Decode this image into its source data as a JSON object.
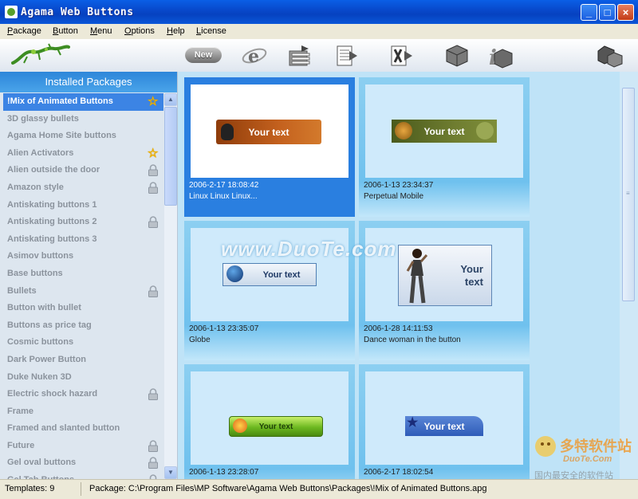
{
  "window": {
    "title": "Agama Web Buttons"
  },
  "menu": [
    "Package",
    "Button",
    "Menu",
    "Options",
    "Help",
    "License"
  ],
  "toolbar": {
    "new_label": "New"
  },
  "sidebar": {
    "header": "Installed Packages",
    "items": [
      {
        "label": "!Mix of Animated Buttons",
        "icon": "star-icon",
        "selected": true
      },
      {
        "label": "3D glassy bullets",
        "icon": ""
      },
      {
        "label": "Agama Home Site buttons",
        "icon": ""
      },
      {
        "label": "Alien Activators",
        "icon": "star-icon"
      },
      {
        "label": "Alien outside the door",
        "icon": "lock-icon"
      },
      {
        "label": "Amazon style",
        "icon": "lock-icon"
      },
      {
        "label": "Antiskating buttons 1",
        "icon": ""
      },
      {
        "label": "Antiskating buttons 2",
        "icon": "lock-icon"
      },
      {
        "label": "Antiskating buttons 3",
        "icon": ""
      },
      {
        "label": "Asimov buttons",
        "icon": ""
      },
      {
        "label": "Base buttons",
        "icon": ""
      },
      {
        "label": "Bullets",
        "icon": "lock-icon"
      },
      {
        "label": "Button with bullet",
        "icon": ""
      },
      {
        "label": "Buttons as price tag",
        "icon": ""
      },
      {
        "label": "Cosmic buttons",
        "icon": ""
      },
      {
        "label": "Dark Power Button",
        "icon": ""
      },
      {
        "label": "Duke Nuken 3D",
        "icon": ""
      },
      {
        "label": "Electric shock hazard",
        "icon": "lock-icon"
      },
      {
        "label": "Frame",
        "icon": ""
      },
      {
        "label": "Framed and slanted button",
        "icon": ""
      },
      {
        "label": "Future",
        "icon": "lock-icon"
      },
      {
        "label": "Gel oval buttons",
        "icon": "lock-icon"
      },
      {
        "label": "Gel Tab Buttons",
        "icon": "lock-icon"
      }
    ]
  },
  "templates": [
    {
      "date": "2006-2-17 18:08:42",
      "name": "Linux Linux Linux...",
      "button_text": "Your text",
      "selected": true
    },
    {
      "date": "2006-1-13 23:34:37",
      "name": "Perpetual Mobile",
      "button_text": "Your text"
    },
    {
      "date": "2006-1-13 23:35:07",
      "name": "Globe",
      "button_text": "Your text"
    },
    {
      "date": "2006-1-28 14:11:53",
      "name": "Dance woman in the button",
      "button_text": "Your text"
    },
    {
      "date": "2006-1-13 23:28:07",
      "name": "",
      "button_text": "Your text"
    },
    {
      "date": "2006-2-17 18:02:54",
      "name": "",
      "button_text": "Your text"
    }
  ],
  "status": {
    "templates": "Templates: 9",
    "package": "Package: C:\\Program Files\\MP Software\\Agama Web Buttons\\Packages\\!Mix of Animated Buttons.apg"
  },
  "watermark": "www.DuoTe.com",
  "corner_logo": {
    "text": "多特软件站",
    "sub": "DuoTe.Com",
    "tagline": "国内最安全的软件站"
  },
  "colors": {
    "accent": "#2a7fe0",
    "header": "#3c92e0",
    "panel": "#bfe3f7",
    "selected_item": "#3c84e4"
  }
}
